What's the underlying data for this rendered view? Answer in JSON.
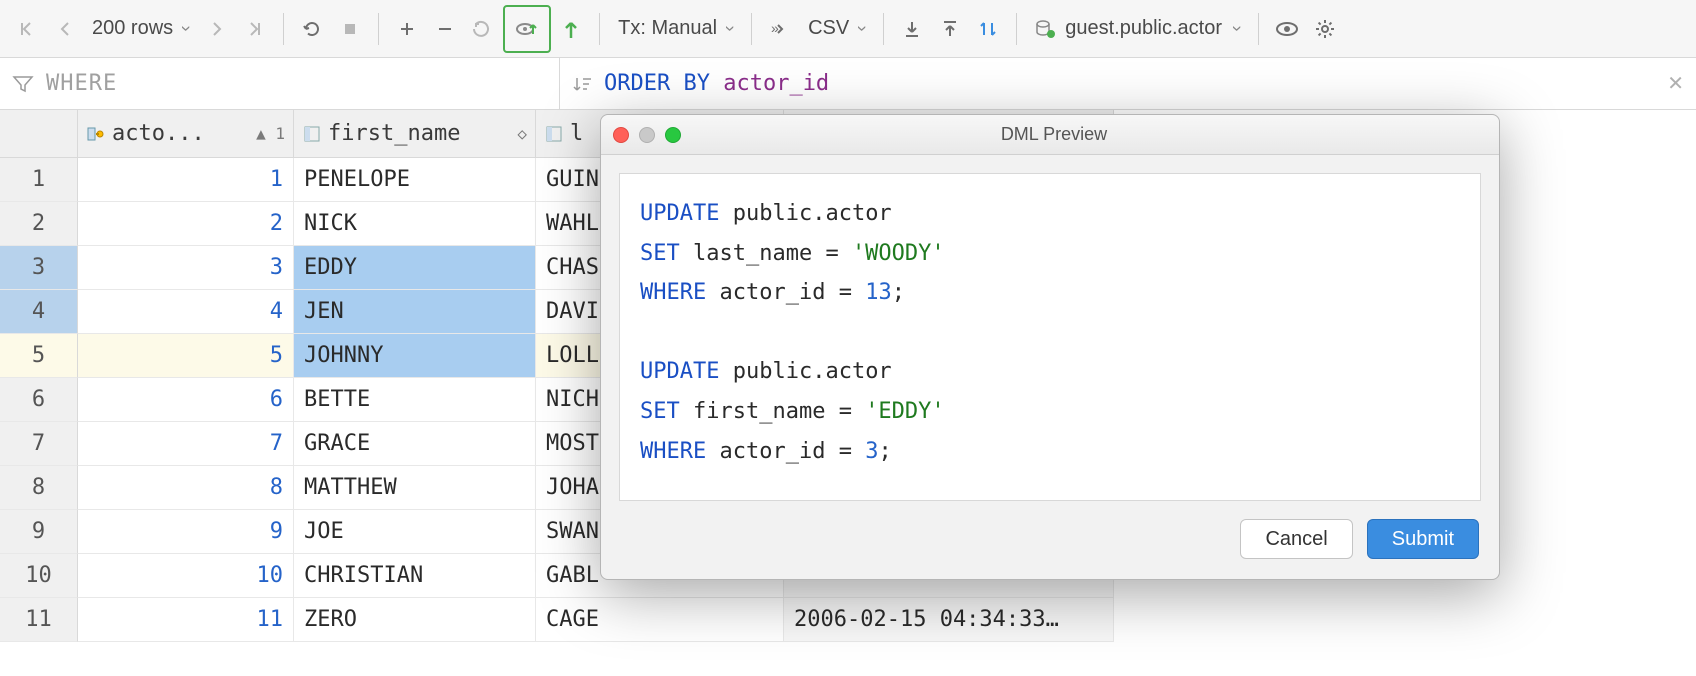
{
  "toolbar": {
    "rows_label": "200 rows",
    "tx_label": "Tx: Manual",
    "export_label": "CSV",
    "datasource": "guest.public.actor"
  },
  "filter": {
    "where_label": "WHERE",
    "orderby_label": "ORDER BY",
    "orderby_value": "actor_id"
  },
  "columns": [
    {
      "name": "acto...",
      "sort": "▲ 1"
    },
    {
      "name": "first_name",
      "sort": "◇"
    },
    {
      "name": "l",
      "sort": ""
    },
    {
      "name": "",
      "sort": ""
    }
  ],
  "rows": [
    {
      "n": 1,
      "id": 1,
      "first": "PENELOPE",
      "last": "GUIN",
      "sel": false
    },
    {
      "n": 2,
      "id": 2,
      "first": "NICK",
      "last": "WAHL",
      "sel": false
    },
    {
      "n": 3,
      "id": 3,
      "first": "EDDY",
      "last": "CHAS",
      "sel": true
    },
    {
      "n": 4,
      "id": 4,
      "first": "JEN",
      "last": "DAVI",
      "sel": true
    },
    {
      "n": 5,
      "id": 5,
      "first": "JOHNNY",
      "last": "LOLL",
      "sel": true,
      "hov": true
    },
    {
      "n": 6,
      "id": 6,
      "first": "BETTE",
      "last": "NICH",
      "sel": false
    },
    {
      "n": 7,
      "id": 7,
      "first": "GRACE",
      "last": "MOST",
      "sel": false
    },
    {
      "n": 8,
      "id": 8,
      "first": "MATTHEW",
      "last": "JOHA",
      "sel": false
    },
    {
      "n": 9,
      "id": 9,
      "first": "JOE",
      "last": "SWAN",
      "sel": false
    },
    {
      "n": 10,
      "id": 10,
      "first": "CHRISTIAN",
      "last": "GABL",
      "sel": false
    },
    {
      "n": 11,
      "id": 11,
      "first": "ZERO",
      "last": "CAGE",
      "sel": false,
      "ts": "2006-02-15 04:34:33…"
    }
  ],
  "dialog": {
    "title": "DML Preview",
    "sql_tokens": [
      [
        "kw",
        "UPDATE "
      ],
      [
        "ident",
        "public"
      ],
      [
        "ident",
        "."
      ],
      [
        "ident",
        "actor"
      ],
      [
        "",
        "\n"
      ],
      [
        "kw",
        "SET "
      ],
      [
        "ident",
        "last_name "
      ],
      [
        "ident",
        "= "
      ],
      [
        "str",
        "'WOODY'"
      ],
      [
        "",
        "\n"
      ],
      [
        "kw",
        "WHERE "
      ],
      [
        "ident",
        "actor_id "
      ],
      [
        "ident",
        "= "
      ],
      [
        "num",
        "13"
      ],
      [
        "ident",
        ";"
      ],
      [
        "",
        "\n"
      ],
      [
        "",
        "\n"
      ],
      [
        "kw",
        "UPDATE "
      ],
      [
        "ident",
        "public"
      ],
      [
        "ident",
        "."
      ],
      [
        "ident",
        "actor"
      ],
      [
        "",
        "\n"
      ],
      [
        "kw",
        "SET "
      ],
      [
        "ident",
        "first_name "
      ],
      [
        "ident",
        "= "
      ],
      [
        "str",
        "'EDDY'"
      ],
      [
        "",
        "\n"
      ],
      [
        "kw",
        "WHERE "
      ],
      [
        "ident",
        "actor_id "
      ],
      [
        "ident",
        "= "
      ],
      [
        "num",
        "3"
      ],
      [
        "ident",
        ";"
      ]
    ],
    "cancel": "Cancel",
    "submit": "Submit"
  }
}
